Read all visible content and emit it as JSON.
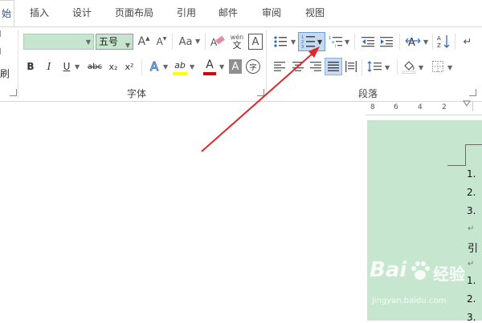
{
  "tabs": [
    {
      "label": "始",
      "active": true
    },
    {
      "label": "插入"
    },
    {
      "label": "设计"
    },
    {
      "label": "页面布局"
    },
    {
      "label": "引用"
    },
    {
      "label": "邮件"
    },
    {
      "label": "审阅"
    },
    {
      "label": "视图"
    }
  ],
  "ribbon": {
    "clipboard_partial_label": "刷",
    "font": {
      "group_label": "字体",
      "font_name_value": "",
      "font_size_value": "五号",
      "grow_font": "A",
      "shrink_font": "A",
      "change_case": "Aa",
      "phonetic_top": "wén",
      "phonetic_bottom": "文",
      "char_border": "A",
      "bold": "B",
      "italic": "I",
      "underline": "U",
      "strikethrough": "abc",
      "subscript": "x₂",
      "superscript": "x²",
      "text_effect": "A",
      "highlight": "ab",
      "font_color": "A",
      "char_shading": "A",
      "enclose": "字",
      "highlight_color": "#ffff00",
      "font_color_bar": "#d40000"
    },
    "paragraph": {
      "group_label": "段落",
      "sort_icon_text": "A↓Z"
    }
  },
  "ruler": {
    "numbers": [
      "8",
      "6",
      "4",
      "2"
    ]
  },
  "document": {
    "list1": [
      "1.",
      "2.",
      "3."
    ],
    "return_mark": "↵",
    "para_text": "引",
    "list2": [
      "1.",
      "2.",
      "3."
    ]
  },
  "watermark": {
    "brand": "Bai",
    "brand2": "经验",
    "url": "jingyan.baidu.com"
  },
  "colors": {
    "accent_blue": "#2b579a",
    "arrow_red": "#e0262b",
    "page_green": "#c6e6cf"
  }
}
